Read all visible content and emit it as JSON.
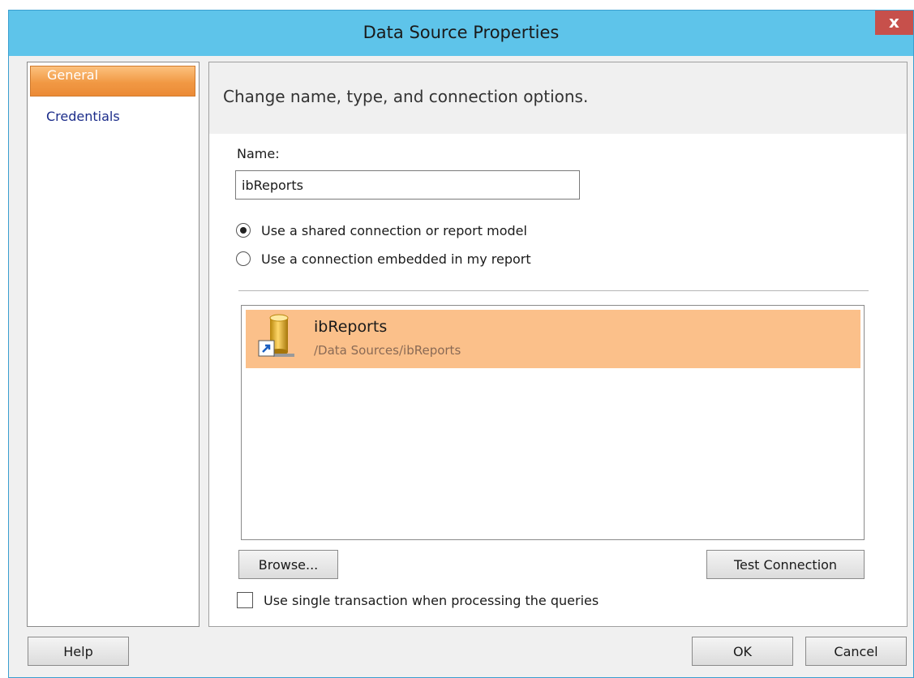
{
  "window": {
    "title": "Data Source Properties",
    "close_label": "x"
  },
  "sidebar": {
    "items": [
      {
        "label": "General",
        "selected": true
      },
      {
        "label": "Credentials",
        "selected": false
      }
    ]
  },
  "main": {
    "header": "Change name, type, and connection options.",
    "name_label": "Name:",
    "name_value": "ibReports",
    "radio_options": [
      {
        "label": "Use a shared connection or report model",
        "checked": true
      },
      {
        "label": "Use a connection embedded in my report",
        "checked": false
      }
    ],
    "data_sources": [
      {
        "name": "ibReports",
        "path": "/Data Sources/ibReports",
        "icon": "shared-database-shortcut-icon"
      }
    ],
    "browse_label": "Browse...",
    "test_connection_label": "Test Connection",
    "single_transaction_label": "Use single transaction when processing the queries",
    "single_transaction_checked": false
  },
  "footer": {
    "help_label": "Help",
    "ok_label": "OK",
    "cancel_label": "Cancel"
  },
  "colors": {
    "titlebar": "#5ec4ea",
    "close_button": "#c7504b",
    "selected_nav": "#f19944",
    "selected_list_item": "#fbc08a"
  }
}
